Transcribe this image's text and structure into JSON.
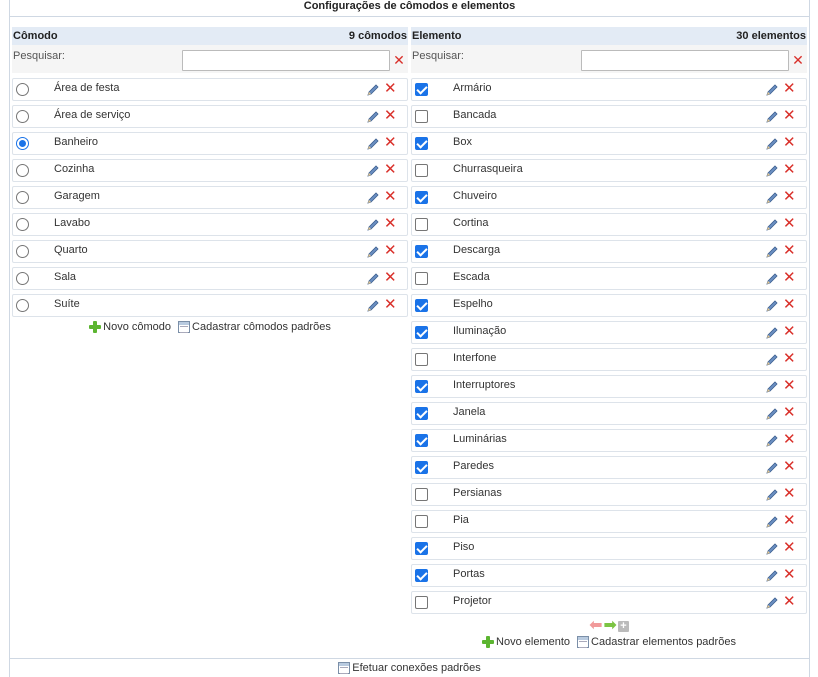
{
  "title": "Configurações de cômodos e elementos",
  "rooms": {
    "header": "Cômodo",
    "count": "9 cômodos",
    "search_label": "Pesquisar:",
    "search_value": "",
    "items": [
      {
        "label": "Área de festa",
        "selected": false
      },
      {
        "label": "Área de serviço",
        "selected": false
      },
      {
        "label": "Banheiro",
        "selected": true
      },
      {
        "label": "Cozinha",
        "selected": false
      },
      {
        "label": "Garagem",
        "selected": false
      },
      {
        "label": "Lavabo",
        "selected": false
      },
      {
        "label": "Quarto",
        "selected": false
      },
      {
        "label": "Sala",
        "selected": false
      },
      {
        "label": "Suíte",
        "selected": false
      }
    ],
    "new_label": "Novo cômodo",
    "defaults_label": "Cadastrar cômodos padrões"
  },
  "elements": {
    "header": "Elemento",
    "count": "30 elementos",
    "search_label": "Pesquisar:",
    "search_value": "",
    "items": [
      {
        "label": "Armário",
        "checked": true
      },
      {
        "label": "Bancada",
        "checked": false
      },
      {
        "label": "Box",
        "checked": true
      },
      {
        "label": "Churrasqueira",
        "checked": false
      },
      {
        "label": "Chuveiro",
        "checked": true
      },
      {
        "label": "Cortina",
        "checked": false
      },
      {
        "label": "Descarga",
        "checked": true
      },
      {
        "label": "Escada",
        "checked": false
      },
      {
        "label": "Espelho",
        "checked": true
      },
      {
        "label": "Iluminação",
        "checked": true
      },
      {
        "label": "Interfone",
        "checked": false
      },
      {
        "label": "Interruptores",
        "checked": true
      },
      {
        "label": "Janela",
        "checked": true
      },
      {
        "label": "Luminárias",
        "checked": true
      },
      {
        "label": "Paredes",
        "checked": true
      },
      {
        "label": "Persianas",
        "checked": false
      },
      {
        "label": "Pia",
        "checked": false
      },
      {
        "label": "Piso",
        "checked": true
      },
      {
        "label": "Portas",
        "checked": true
      },
      {
        "label": "Projetor",
        "checked": false
      }
    ],
    "new_label": "Novo elemento",
    "defaults_label": "Cadastrar elementos padrões"
  },
  "footer": {
    "connect_label": "Efetuar conexões padrões"
  },
  "colors": {
    "header_bg": "#e3ebf5",
    "accent": "#1a73e8",
    "delete": "#d9302a",
    "add": "#5cb531"
  }
}
